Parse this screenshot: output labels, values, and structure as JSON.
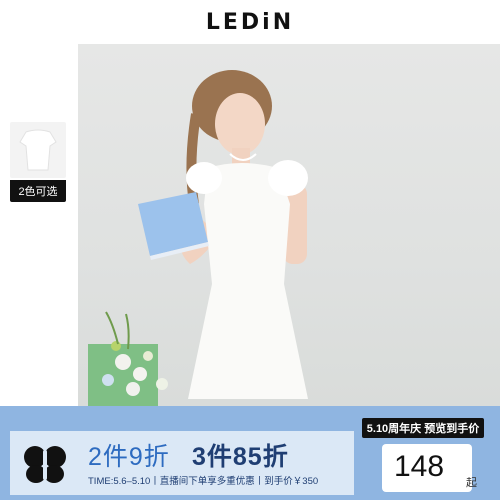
{
  "brand": {
    "name": "LEDiN"
  },
  "color_options": {
    "label": "2色可选"
  },
  "promo_tag": {
    "label": "5.10周年庆 预览到手价"
  },
  "banner": {
    "offer_one": "2件9折",
    "offer_two": "3件85折",
    "fine_print": "TIME:5.6–5.10丨直播间下单享多重优惠丨到手价￥350",
    "price": "148",
    "price_unit": "起"
  },
  "colors": {
    "banner_blue": "#8fb5e1",
    "banner_light": "#dbe8f6",
    "offer_blue": "#2d6bc0",
    "offer_navy": "#1f3e73"
  }
}
